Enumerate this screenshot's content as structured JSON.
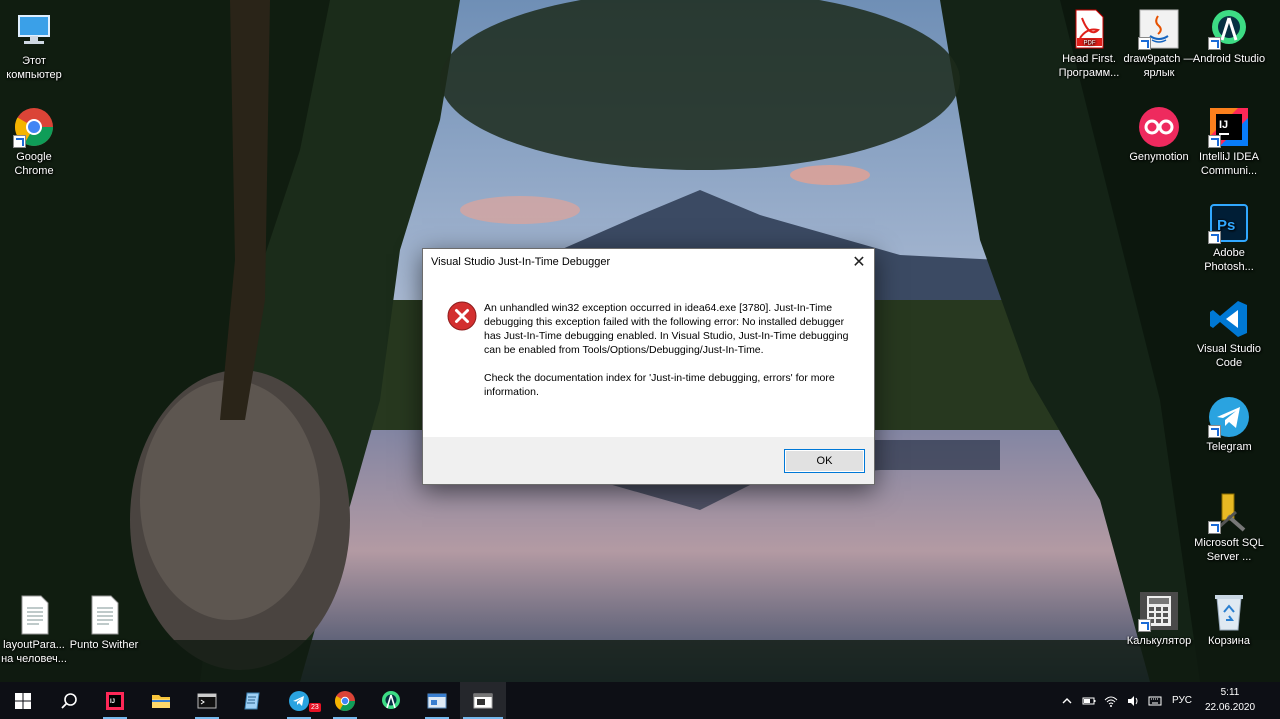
{
  "desktop": {
    "icons": [
      {
        "key": "this-pc",
        "label": "Этот компьютер"
      },
      {
        "key": "chrome",
        "label": "Google Chrome"
      },
      {
        "key": "layout",
        "label": "layoutPara... на человеч..."
      },
      {
        "key": "punto",
        "label": "Punto Swither"
      },
      {
        "key": "headfirst",
        "label": "Head First. Программ..."
      },
      {
        "key": "draw9patch",
        "label": "draw9patch — ярлык"
      },
      {
        "key": "android-studio",
        "label": "Android Studio"
      },
      {
        "key": "genymotion",
        "label": "Genymotion"
      },
      {
        "key": "intellij",
        "label": "IntelliJ IDEA Communi..."
      },
      {
        "key": "photoshop",
        "label": "Adobe Photosh..."
      },
      {
        "key": "vscode",
        "label": "Visual Studio Code"
      },
      {
        "key": "telegram",
        "label": "Telegram"
      },
      {
        "key": "sqlserver",
        "label": "Microsoft SQL Server ..."
      },
      {
        "key": "calculator",
        "label": "Калькулятор"
      },
      {
        "key": "recycle",
        "label": "Корзина"
      }
    ]
  },
  "dialog": {
    "title": "Visual Studio Just-In-Time Debugger",
    "close_glyph": "✕",
    "message": [
      "An unhandled win32 exception occurred in idea64.exe [3780]. Just-In-Time debugging this exception failed with the following error: No installed debugger has Just-In-Time debugging enabled. In Visual Studio, Just-In-Time debugging can be enabled from Tools/Options/Debugging/Just-In-Time.",
      "Check the documentation index for 'Just-in-time debugging, errors' for more information."
    ],
    "ok_label": "OK"
  },
  "taskbar": {
    "telegram_badge": "23",
    "language": "РУС",
    "time": "5:11",
    "date": "22.06.2020"
  },
  "colors": {
    "accent": "#0078d7",
    "taskbar": "#0d0f15",
    "error_red": "#d32f2f"
  }
}
